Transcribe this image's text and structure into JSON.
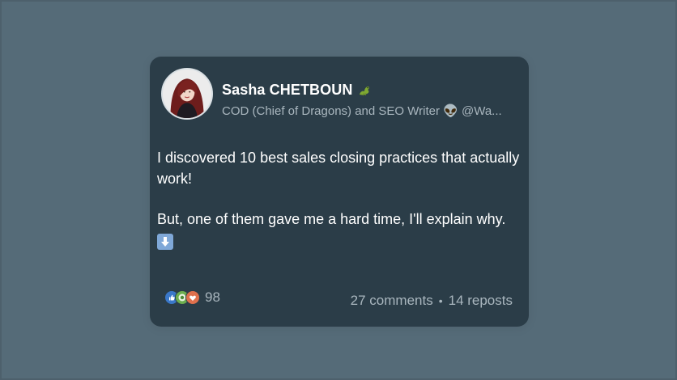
{
  "post": {
    "author": {
      "name": "Sasha CHETBOUN",
      "headline": "COD (Chief of Dragons) and SEO Writer 👽  @Wa..."
    },
    "body": {
      "line1": "I discovered 10 best sales closing practices that actually work!",
      "line2": "But, one of them gave me a hard time, I'll explain why."
    },
    "reactions": {
      "count": "98",
      "icons": [
        "like-icon",
        "celebrate-icon",
        "love-icon"
      ]
    },
    "stats": {
      "comments": "27 comments",
      "separator": "•",
      "reposts": "14 reposts"
    },
    "colors": {
      "page_bg": "#556b78",
      "card_bg": "#2b3d48",
      "text_primary": "#ffffff",
      "text_secondary": "#a9b6be"
    }
  }
}
